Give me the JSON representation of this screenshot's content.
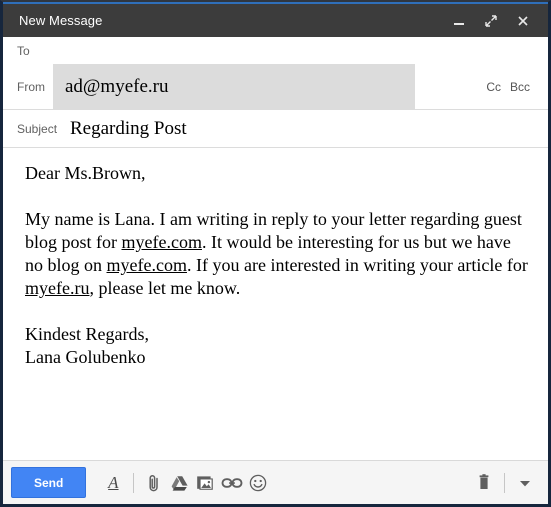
{
  "window": {
    "title": "New Message",
    "controls": [
      {
        "name": "minimize",
        "label": "–"
      },
      {
        "name": "expand",
        "label": "⤡"
      },
      {
        "name": "close",
        "label": "✕"
      }
    ],
    "titlebar_color": "#3c3c3c",
    "accent_color": "#2f6fba"
  },
  "fields": {
    "to_label": "To",
    "to_value": "",
    "from_label": "From",
    "from_value": "ad@myefe.ru",
    "cc_label": "Cc",
    "bcc_label": "Bcc",
    "subject_label": "Subject",
    "subject_value": "Regarding Post",
    "from_box_color": "#dcdcdc"
  },
  "body": {
    "greeting": "Dear Ms.Brown,",
    "paragraph_1": {
      "part_1": "My name is Lana. I am writing in reply to your letter regarding guest blog post for ",
      "link_1": "myefe.com",
      "part_2": ". It would be interesting for us but we have no blog on ",
      "link_2": "myefe.com",
      "part_3": ". If you are interested in writing your article for ",
      "link_3": "myefe.ru",
      "part_4": ", please let me know."
    },
    "signoff_line_1": "Kindest Regards,",
    "signoff_line_2": "Lana Golubenko"
  },
  "toolbar": {
    "send_label": "Send",
    "send_color": "#4285f4",
    "icons": [
      {
        "name": "formatting-options-icon",
        "glyph": "A"
      },
      {
        "name": "attach-file-icon",
        "glyph": "paperclip"
      },
      {
        "name": "insert-drive-icon",
        "glyph": "drive"
      },
      {
        "name": "insert-photo-icon",
        "glyph": "photo"
      },
      {
        "name": "insert-link-icon",
        "glyph": "link"
      },
      {
        "name": "insert-emoji-icon",
        "glyph": "emoji"
      }
    ],
    "discard_icon": "trash",
    "more_options_icon": "chevron-down"
  }
}
